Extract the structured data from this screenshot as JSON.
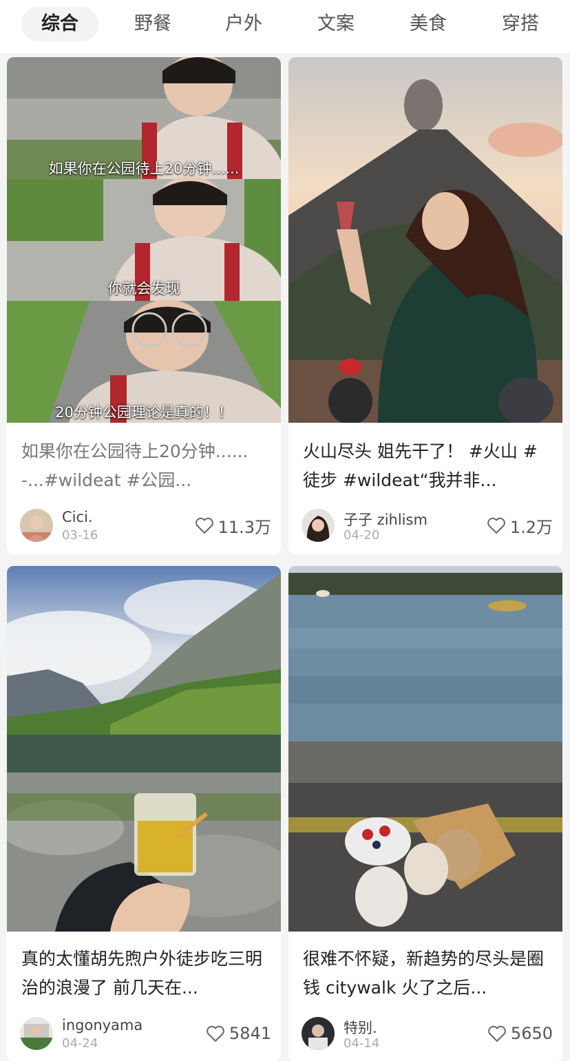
{
  "tabs": [
    {
      "label": "综合",
      "active": true
    },
    {
      "label": "野餐",
      "active": false
    },
    {
      "label": "户外",
      "active": false
    },
    {
      "label": "文案",
      "active": false
    },
    {
      "label": "美食",
      "active": false
    },
    {
      "label": "穿搭",
      "active": false
    }
  ],
  "posts": [
    {
      "title": "如果你在公园待上20分钟...... -...#wildeat #公园...",
      "author": "Cici.",
      "date": "03-16",
      "likes": "11.3万",
      "captions": [
        "如果你在公园待上20分钟......",
        "你就会发现",
        "20分钟公园理论是真的！！"
      ]
    },
    {
      "title": "火山尽头 姐先干了！ #火山 #徒步 #wildeat“我并非...",
      "author": "子子 zihlism",
      "date": "04-20",
      "likes": "1.2万"
    },
    {
      "title": "真的太懂胡先煦户外徒步吃三明治的浪漫了 前几天在...",
      "author": "ingonyama",
      "date": "04-24",
      "likes": "5841"
    },
    {
      "title": "很难不怀疑，新趋势的尽头是圈钱 citywalk 火了之后...",
      "author": "特别.",
      "date": "04-14",
      "likes": "5650"
    }
  ]
}
